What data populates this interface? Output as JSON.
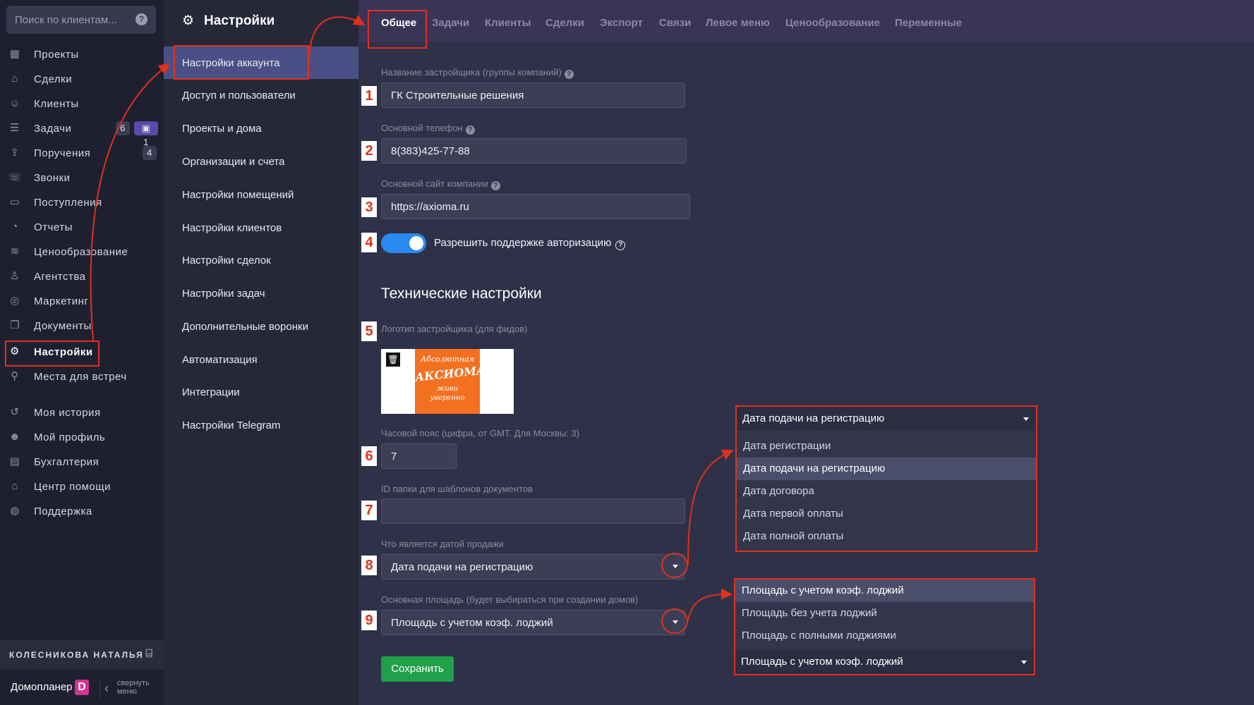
{
  "search": {
    "placeholder": "Поиск по клиентам..."
  },
  "sidebar": {
    "items": [
      {
        "label": "Проекты",
        "icon": "building-icon"
      },
      {
        "label": "Сделки",
        "icon": "handshake-icon"
      },
      {
        "label": "Клиенты",
        "icon": "users-icon"
      },
      {
        "label": "Задачи",
        "icon": "list-icon",
        "badge": "6",
        "badge2": "1"
      },
      {
        "label": "Поручения",
        "icon": "inbox-icon",
        "badge": "4"
      },
      {
        "label": "Звонки",
        "icon": "phone-icon"
      },
      {
        "label": "Поступления",
        "icon": "wallet-icon"
      },
      {
        "label": "Отчеты",
        "icon": "chart-pie-icon"
      },
      {
        "label": "Ценообразование",
        "icon": "coins-icon"
      },
      {
        "label": "Агентства",
        "icon": "agent-icon"
      },
      {
        "label": "Маркетинг",
        "icon": "target-icon"
      },
      {
        "label": "Документы",
        "icon": "documents-icon"
      },
      {
        "label": "Настройки",
        "icon": "gear-icon"
      },
      {
        "label": "Места для встреч",
        "icon": "meeting-icon"
      },
      {
        "label": "Моя история",
        "icon": "history-icon"
      },
      {
        "label": "Мой профиль",
        "icon": "profile-icon"
      },
      {
        "label": "Бухгалтерия",
        "icon": "accounting-icon"
      },
      {
        "label": "Центр помощи",
        "icon": "help-center-icon"
      },
      {
        "label": "Поддержка",
        "icon": "support-icon"
      }
    ],
    "user": "КОЛЕСНИКОВА НАТАЛЬЯ",
    "brand": "Домопланер",
    "brand_letter": "D",
    "collapse_line1": "свернуть",
    "collapse_line2": "меню"
  },
  "settings": {
    "title": "Настройки",
    "items": [
      "Настройки аккаунта",
      "Доступ и пользователи",
      "Проекты и дома",
      "Организации и счета",
      "Настройки помещений",
      "Настройки клиентов",
      "Настройки сделок",
      "Настройки задач",
      "Дополнительные воронки",
      "Автоматизация",
      "Интеграции",
      "Настройки Telegram"
    ]
  },
  "tabs": [
    "Общее",
    "Задачи",
    "Клиенты",
    "Сделки",
    "Экспорт",
    "Связи",
    "Левое меню",
    "Ценообразование",
    "Переменные"
  ],
  "form": {
    "company_label": "Название застройщика (группы компаний)",
    "company_value": "ГК Строительные решения",
    "phone_label": "Основной телефон",
    "phone_value": "8(383)425-77-88",
    "site_label": "Основной сайт компании",
    "site_value": "https://axioma.ru",
    "support_toggle_label": "Разрешить поддержке авторизацию",
    "tech_title": "Технические настройки",
    "logo_label": "Логотип застройщика (для фидов)",
    "logo_line1": "Абсолютная",
    "logo_line2": "АКСИОМА",
    "logo_line3a": "живи",
    "logo_line3b": "уверенно",
    "tz_label": "Часовой пояс (цифра, от GMT. Для Москвы: 3)",
    "tz_value": "7",
    "folder_label": "ID папки для шаблонов документов",
    "folder_value": "",
    "sale_date_label": "Что является датой продажи",
    "sale_date_value": "Дата подачи на регистрацию",
    "area_label": "Основная площадь (будет выбираться при создании домов)",
    "area_value": "Площадь с учетом коэф. лоджий",
    "save": "Сохранить"
  },
  "markers": [
    "1",
    "2",
    "3",
    "4",
    "5",
    "6",
    "7",
    "8",
    "9"
  ],
  "sale_date_popup": {
    "selected": "Дата подачи на регистрацию",
    "options": [
      "Дата регистрации",
      "Дата подачи на регистрацию",
      "Дата договора",
      "Дата первой оплаты",
      "Дата полной оплаты"
    ]
  },
  "area_popup": {
    "options": [
      "Площадь с учетом коэф. лоджий",
      "Площадь без учета лоджий",
      "Площадь с полными лоджиями"
    ],
    "selected": "Площадь с учетом коэф. лоджий"
  },
  "colors": {
    "accent": "#2a8af0",
    "annotation": "#e0301e",
    "save": "#1fa14a",
    "active_item": "#4a5085"
  }
}
